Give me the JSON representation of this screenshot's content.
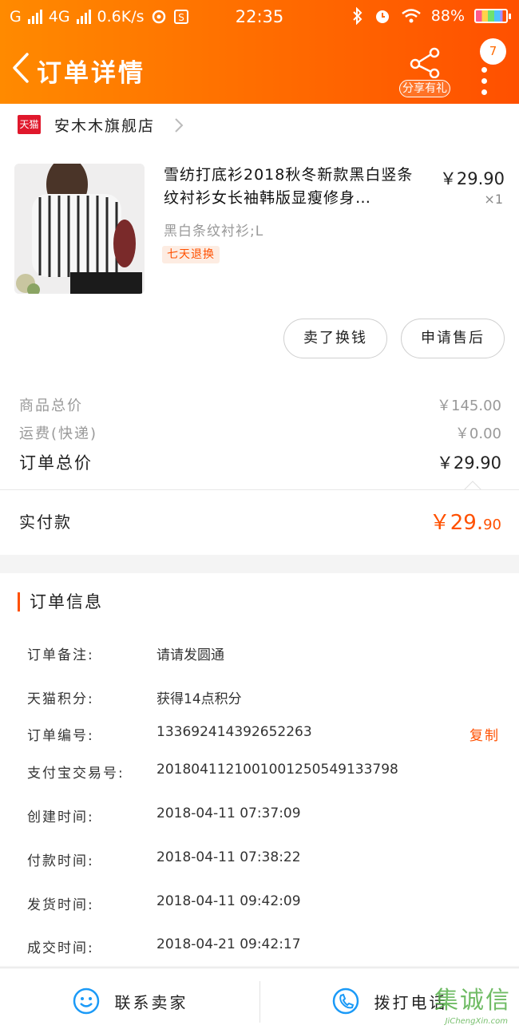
{
  "status_bar": {
    "carrier1": "G",
    "carrier2": "4G",
    "speed": "0.6K/s",
    "time": "22:35",
    "battery": "88%"
  },
  "nav": {
    "title": "订单详情",
    "share_label": "分享有礼",
    "badge_count": "7"
  },
  "shop": {
    "badge": "天猫",
    "name": "安木木旗舰店"
  },
  "product": {
    "title": "雪纺打底衫2018秋冬新款黑白竖条纹衬衫女长袖韩版显瘦修身…",
    "price": "￥29.90",
    "qty": "×1",
    "sku": "黑白条纹衬衫;L",
    "return_tag": "七天退换"
  },
  "actions": {
    "sell_label": "卖了换钱",
    "aftersale_label": "申请售后"
  },
  "summary": {
    "goods_total_label": "商品总价",
    "goods_total_value": "￥145.00",
    "shipping_label": "运费(快递)",
    "shipping_value": "￥0.00",
    "order_total_label": "订单总价",
    "order_total_value": "￥29.90",
    "paid_label": "实付款",
    "paid_main": "￥29.",
    "paid_cents": "90"
  },
  "order_info": {
    "title": "订单信息",
    "copy_label": "复制",
    "rows": [
      {
        "key": "订单备注:",
        "value": "请请发圆通"
      },
      {
        "key": "天猫积分:",
        "value": "获得14点积分"
      },
      {
        "key": "订单编号:",
        "value": "133692414392652263"
      },
      {
        "key": "支付宝交易号:",
        "value": "2018041121001001250549133798"
      },
      {
        "key": "创建时间:",
        "value": "2018-04-11 07:37:09"
      },
      {
        "key": "付款时间:",
        "value": "2018-04-11 07:38:22"
      },
      {
        "key": "发货时间:",
        "value": "2018-04-11 09:42:09"
      },
      {
        "key": "成交时间:",
        "value": "2018-04-21 09:42:17"
      }
    ]
  },
  "bottom": {
    "contact_label": "联系卖家",
    "call_label": "拨打电话"
  },
  "watermark": {
    "text": "集诚信",
    "sub": "JiChengXin.com"
  },
  "colors": {
    "accent": "#ff5000",
    "header_start": "#ff8a00",
    "header_end": "#ff5000",
    "icon_blue": "#1b9af7"
  }
}
